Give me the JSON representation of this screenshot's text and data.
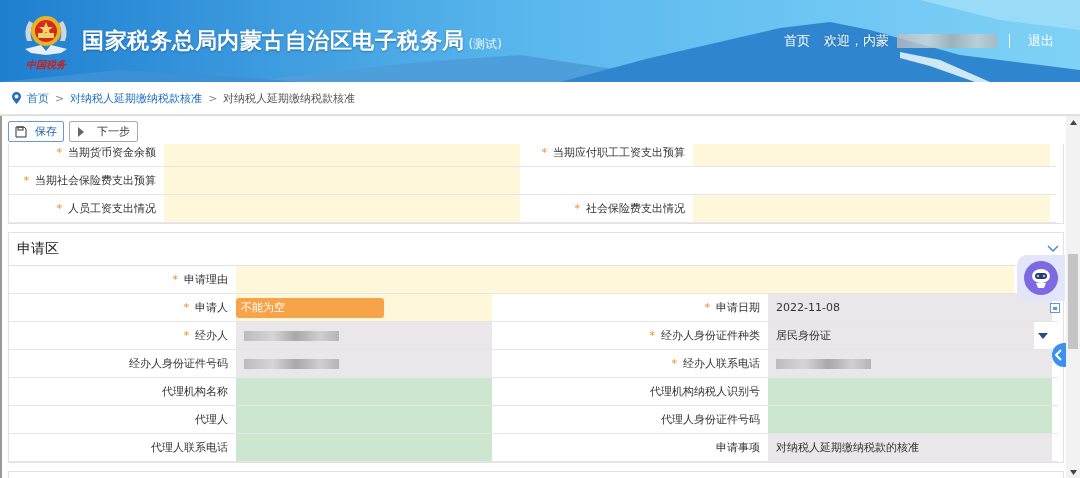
{
  "header": {
    "logo_caption": "中国税务",
    "title": "国家税务总局内蒙古自治区电子税务局",
    "title_suffix": "(测试)",
    "nav": [
      {
        "label": "首页",
        "kind": "link"
      },
      {
        "label": "欢迎，内蒙",
        "kind": "user",
        "redacted": true
      },
      {
        "label": "退出",
        "kind": "link"
      }
    ]
  },
  "breadcrumb": {
    "separator": ">",
    "items": [
      {
        "label": "首页",
        "link": true
      },
      {
        "label": "对纳税人延期缴纳税款核准",
        "link": true
      },
      {
        "label": "对纳税人延期缴纳税款核准",
        "link": false
      }
    ]
  },
  "toolbar": [
    {
      "label": "保存",
      "kind": "save"
    },
    {
      "label": "下一步",
      "kind": "next"
    }
  ],
  "required_mark": "*",
  "sections": [
    {
      "rows": [
        [
          {
            "label": "当期货币资金余额",
            "required": true,
            "color": "#fef7da"
          },
          {
            "label": "当期应付职工工资支出预算",
            "required": true,
            "color": "#fef7da"
          }
        ],
        [
          {
            "label": "当期社会保险费支出预算",
            "required": true,
            "color": "#fef7da"
          }
        ],
        [
          {
            "label": "人员工资支出情况",
            "required": true,
            "color": "#fef7da"
          },
          {
            "label": "社会保险费支出情况",
            "required": true,
            "color": "#fef7da"
          }
        ]
      ]
    },
    {
      "title": "申请区",
      "expanded": true,
      "rows": [
        [
          {
            "label": "申请理由",
            "required": true,
            "color": "#fef7da",
            "wide": true
          }
        ],
        [
          {
            "label": "申请人",
            "required": true,
            "color": "#fef7da",
            "error": "不能为空"
          },
          {
            "label": "申请日期",
            "required": true,
            "color": "#e9e7e9",
            "kind": "date",
            "value": "2022-11-08"
          }
        ],
        [
          {
            "label": "经办人",
            "required": true,
            "color": "#e9e7e9",
            "redacted": true
          },
          {
            "label": "经办人身份证件种类",
            "required": true,
            "color": "#e9e7e9",
            "kind": "select",
            "value": "居民身份证"
          }
        ],
        [
          {
            "label": "经办人身份证件号码",
            "required": false,
            "color": "#e9e7e9",
            "redacted": true
          },
          {
            "label": "经办人联系电话",
            "required": true,
            "color": "#e9e7e9",
            "redacted": true
          }
        ],
        [
          {
            "label": "代理机构名称",
            "required": false,
            "color": "#cde6cf"
          },
          {
            "label": "代理机构纳税人识别号",
            "required": false,
            "color": "#cde6cf"
          }
        ],
        [
          {
            "label": "代理人",
            "required": false,
            "color": "#cde6cf"
          },
          {
            "label": "代理人身份证件号码",
            "required": false,
            "color": "#cde6cf"
          }
        ],
        [
          {
            "label": "代理人联系电话",
            "required": false,
            "color": "#cde6cf"
          },
          {
            "label": "申请事项",
            "required": false,
            "color": "#e9e7e9",
            "value": "对纳税人延期缴纳税款的核准"
          }
        ]
      ]
    }
  ]
}
